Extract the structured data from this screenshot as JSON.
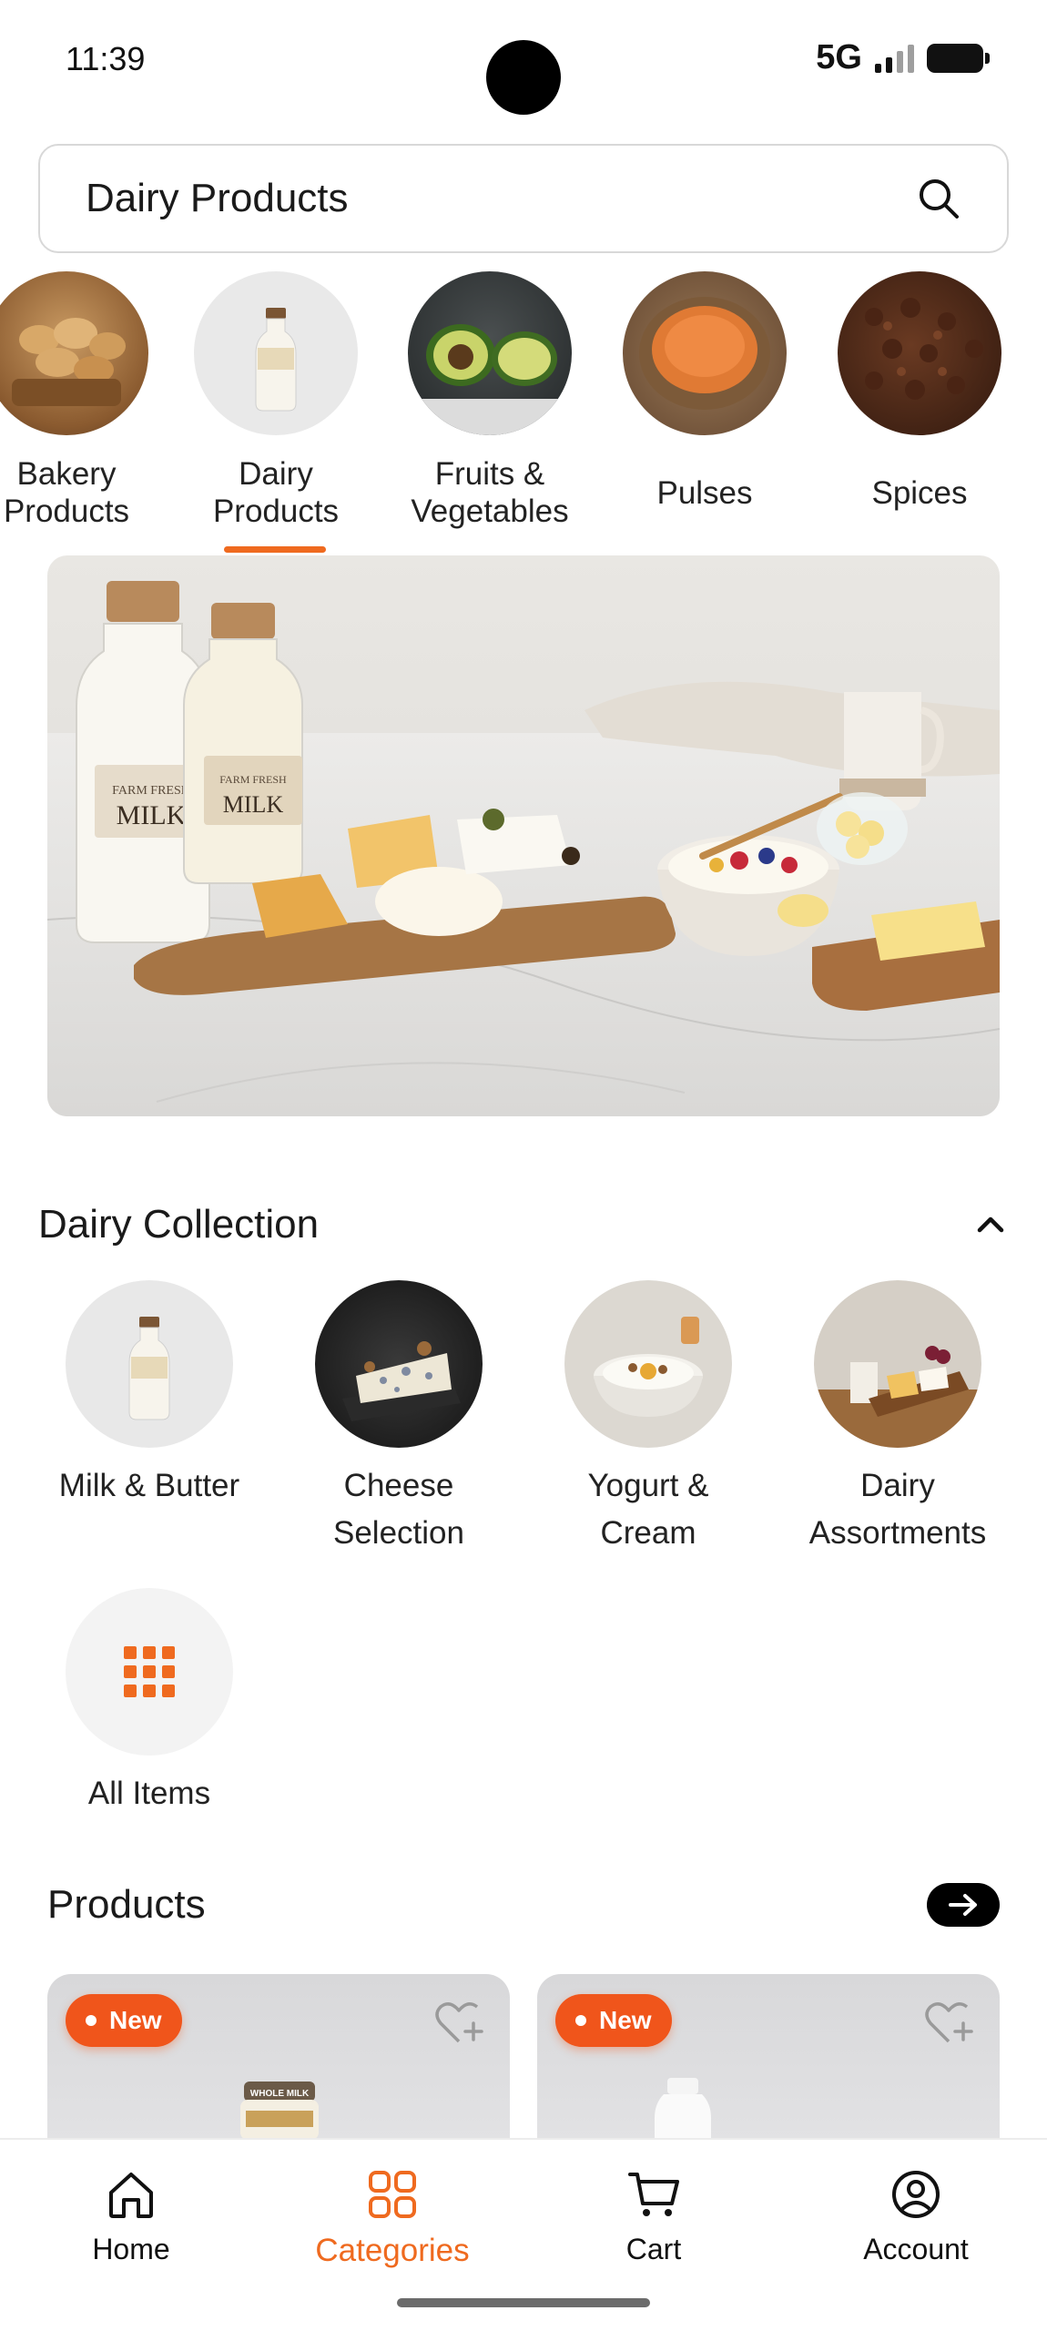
{
  "status_bar": {
    "time": "11:39",
    "network": "5G"
  },
  "search": {
    "value": "Dairy Products"
  },
  "categories": [
    {
      "label": "Bakery\nProducts",
      "icon": "bread-basket-image"
    },
    {
      "label": "Dairy\nProducts",
      "icon": "milk-bottle-image",
      "selected": true
    },
    {
      "label": "Fruits &\nVegetables",
      "icon": "avocado-image"
    },
    {
      "label": "Pulses",
      "icon": "lentils-bowl-image"
    },
    {
      "label": "Spices",
      "icon": "cloves-image"
    }
  ],
  "hero": {
    "bottle_text_1": "FARM FRESH",
    "bottle_text_2": "MILK"
  },
  "collection": {
    "title": "Dairy Collection",
    "items": [
      {
        "label": "Milk & Butter"
      },
      {
        "label": "Cheese\nSelection"
      },
      {
        "label": "Yogurt &\nCream"
      },
      {
        "label": "Dairy\nAssortments"
      },
      {
        "label": "All Items"
      }
    ]
  },
  "products": {
    "title": "Products",
    "cards": [
      {
        "badge": "New",
        "jar_text": "WHOLE MILK"
      },
      {
        "badge": "New"
      }
    ]
  },
  "nav": {
    "items": [
      {
        "label": "Home"
      },
      {
        "label": "Categories",
        "active": true
      },
      {
        "label": "Cart"
      },
      {
        "label": "Account"
      }
    ]
  },
  "colors": {
    "accent": "#ef6a1f",
    "badge": "#f0551b"
  }
}
